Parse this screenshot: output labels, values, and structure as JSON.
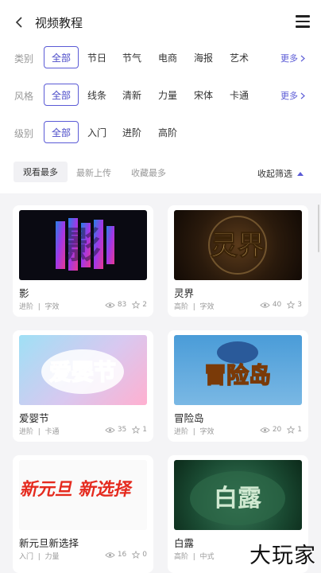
{
  "header": {
    "title": "视频教程"
  },
  "filters": {
    "category": {
      "label": "类别",
      "selected": "全部",
      "options": [
        "节日",
        "节气",
        "电商",
        "海报",
        "艺术"
      ],
      "more": "更多"
    },
    "style": {
      "label": "风格",
      "selected": "全部",
      "options": [
        "线条",
        "清新",
        "力量",
        "宋体",
        "卡通"
      ],
      "more": "更多"
    },
    "level": {
      "label": "级别",
      "selected": "全部",
      "options": [
        "入门",
        "进阶",
        "高阶"
      ]
    }
  },
  "sort": {
    "options": [
      "观看最多",
      "最新上传",
      "收藏最多"
    ],
    "collapse": "收起筛选"
  },
  "cards": [
    {
      "title": "影",
      "level": "进阶",
      "tag": "字效",
      "views": "83",
      "stars": "2",
      "thumb_text": "影"
    },
    {
      "title": "灵界",
      "level": "高阶",
      "tag": "字效",
      "views": "40",
      "stars": "3",
      "thumb_text": "灵界"
    },
    {
      "title": "爱婴节",
      "level": "进阶",
      "tag": "卡通",
      "views": "35",
      "stars": "1",
      "thumb_text": "爱婴节"
    },
    {
      "title": "冒险岛",
      "level": "进阶",
      "tag": "字效",
      "views": "20",
      "stars": "1",
      "thumb_text": "冒险岛"
    },
    {
      "title": "新元旦新选择",
      "level": "入门",
      "tag": "力量",
      "views": "16",
      "stars": "0",
      "thumb_text": "新元旦 新选择"
    },
    {
      "title": "白露",
      "level": "高阶",
      "tag": "中式",
      "views": "",
      "stars": "",
      "thumb_text": "白露"
    }
  ],
  "watermark": "大玩家",
  "colors": {
    "accent": "#5b5bd6",
    "background": "#f4f4f6"
  }
}
